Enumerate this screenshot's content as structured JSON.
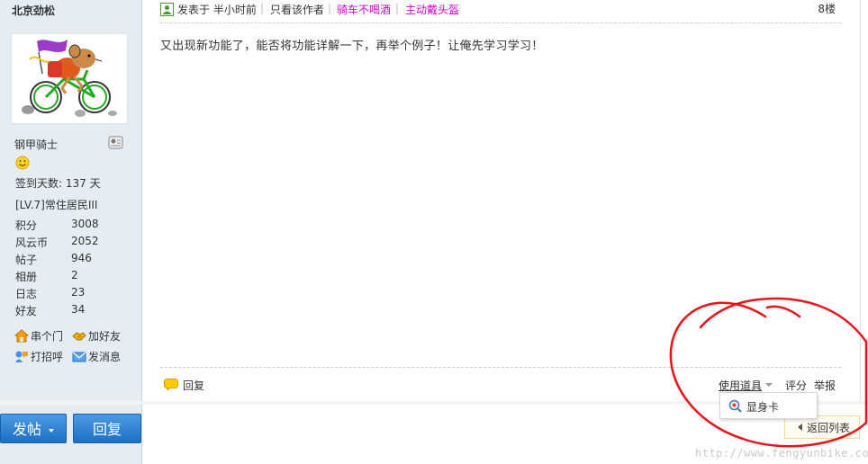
{
  "profile": {
    "username": "北京劲松",
    "rank_title": "钢甲骑士",
    "checkin": "签到天数: 137 天",
    "level": "[LV.7]常住居民III",
    "stats": [
      {
        "label": "积分",
        "value": "3008"
      },
      {
        "label": "风云币",
        "value": "2052"
      },
      {
        "label": "帖子",
        "value": "946"
      },
      {
        "label": "相册",
        "value": "2"
      },
      {
        "label": "日志",
        "value": "23"
      },
      {
        "label": "好友",
        "value": "34"
      }
    ],
    "actions": {
      "visit": "串个门",
      "add_friend": "加好友",
      "greet": "打招呼",
      "message": "发消息"
    }
  },
  "post": {
    "posted": "发表于 半小时前",
    "separator": "|",
    "only_author": "只看该作者",
    "medal1": "骑车不喝酒",
    "medal2": "主动戴头盔",
    "floor": "8楼",
    "body": "又出现新功能了，能否将功能详解一下，再举个例子！让俺先学习学习！"
  },
  "footer": {
    "reply": "回复",
    "tools": "使用道具",
    "rate": "评分",
    "report": "举报"
  },
  "dropdown": {
    "item": "显身卡"
  },
  "bottom": {
    "post_button": "发帖",
    "reply_button": "回复",
    "back_to_list": "返回列表"
  },
  "watermark": "http://www.fengyunbike.com",
  "colors": {
    "sidebar_bg": "#e5edf2",
    "medal": "#cc00cc",
    "button": "#1d6fc2",
    "annotation": "#e8141c"
  }
}
